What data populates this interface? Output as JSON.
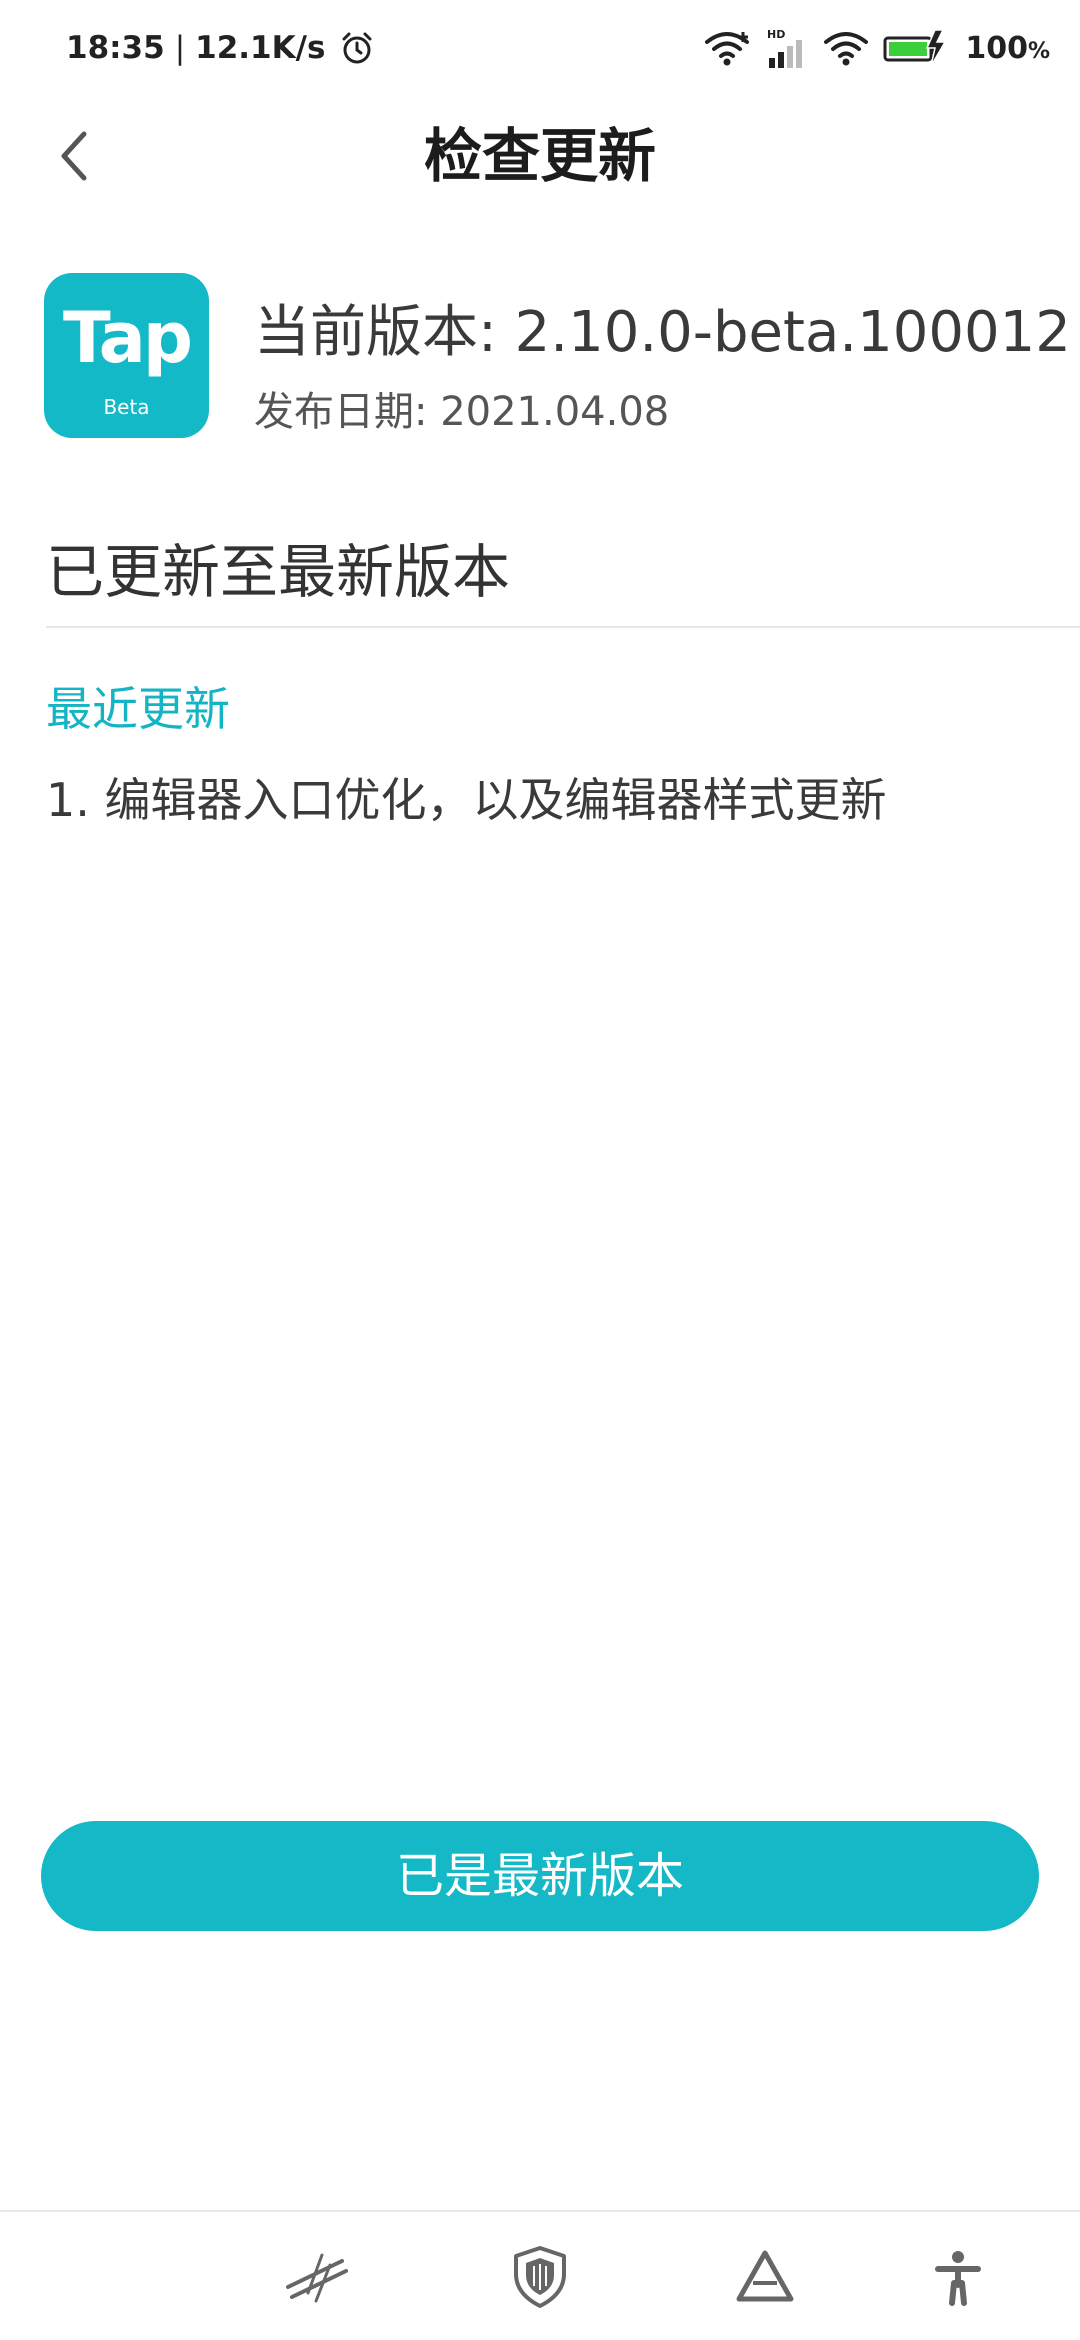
{
  "status_bar": {
    "time": "18:35",
    "separator": "|",
    "net_speed": "12.1K/s",
    "battery_value": "100",
    "battery_unit": "%",
    "icons": [
      "alarm-icon",
      "wifi-icon",
      "hd-signal-icon",
      "wifi-icon",
      "battery-charging-icon"
    ]
  },
  "header": {
    "title": "检查更新",
    "back_icon": "chevron-left-icon"
  },
  "app": {
    "logo_text": "Tap",
    "logo_sub": "Beta",
    "version_label": "当前版本: 2.10.0-beta.100012",
    "release_label": "发布日期: 2021.04.08"
  },
  "status_message": "已更新至最新版本",
  "recent_updates": {
    "title": "最近更新",
    "items": [
      "1. 编辑器入口优化，以及编辑器样式更新"
    ]
  },
  "action_button": {
    "label": "已是最新版本"
  },
  "bottom_nav": {
    "icons": [
      "slash-lines-icon",
      "shield-icon",
      "triangle-icon",
      "accessibility-icon"
    ]
  },
  "colors": {
    "accent": "#14b9c8",
    "text_primary": "#333333"
  }
}
